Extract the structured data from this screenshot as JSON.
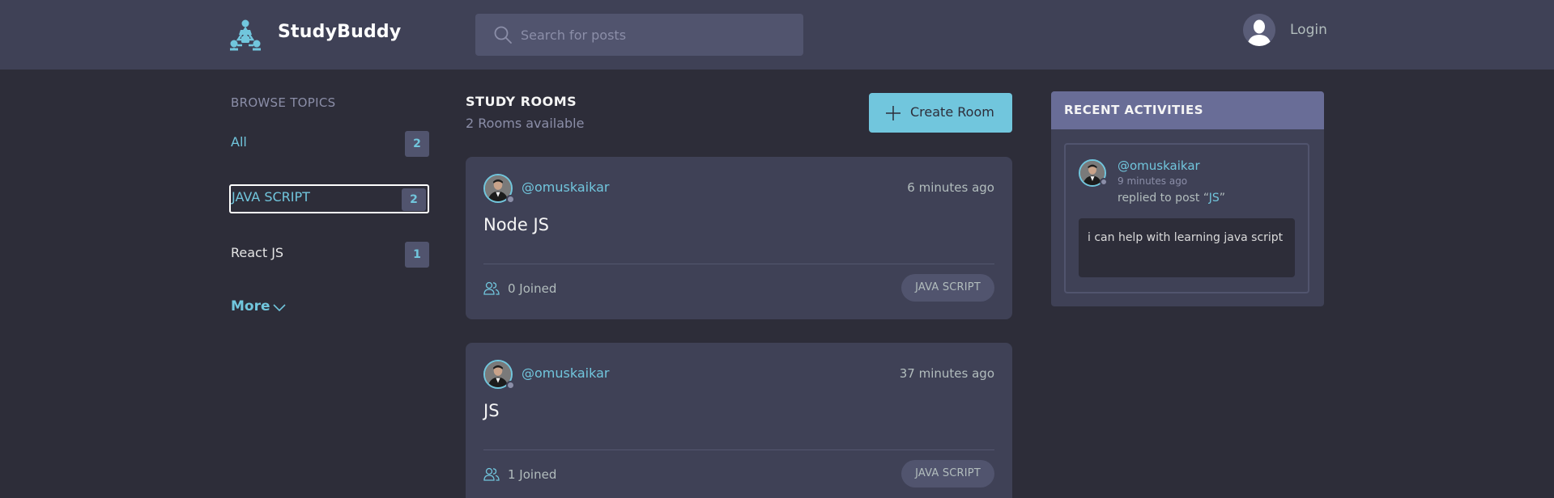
{
  "header": {
    "brand": "StudyBuddy",
    "search_placeholder": "Search for posts",
    "login_label": "Login"
  },
  "sidebar": {
    "title": "BROWSE TOPICS",
    "topics": [
      {
        "label": "All",
        "count": "2"
      },
      {
        "label": "JAVA SCRIPT",
        "count": "2"
      },
      {
        "label": "React JS",
        "count": "1"
      }
    ],
    "more_label": "More"
  },
  "main": {
    "title": "STUDY ROOMS",
    "subtitle": "2 Rooms available",
    "create_label": "Create Room",
    "rooms": [
      {
        "user": "@omuskaikar",
        "time": "6 minutes ago",
        "title": "Node JS",
        "joined": "0 Joined",
        "topic": "JAVA SCRIPT"
      },
      {
        "user": "@omuskaikar",
        "time": "37 minutes ago",
        "title": "JS",
        "joined": "1 Joined",
        "topic": "JAVA SCRIPT"
      }
    ]
  },
  "activities": {
    "title": "RECENT ACTIVITIES",
    "items": [
      {
        "user": "@omuskaikar",
        "time": "9 minutes ago",
        "action_prefix": "replied to post “",
        "post": "JS",
        "action_suffix": "”",
        "body": "i can help with learning java script"
      }
    ]
  },
  "colors": {
    "background": "#2d2d39",
    "header": "#3f4156",
    "accent": "#71c6dd",
    "panel_header": "#696d97"
  },
  "icons": {
    "logo": "people-network-icon",
    "search": "search-icon",
    "avatar": "user-avatar-icon",
    "more": "chevron-down-icon",
    "create": "plus-icon",
    "joined": "people-icon"
  }
}
